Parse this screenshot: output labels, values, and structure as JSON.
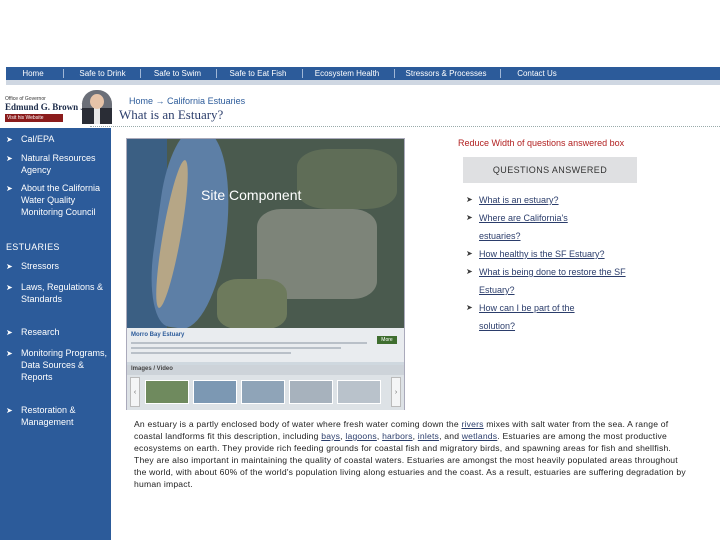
{
  "nav": {
    "items": [
      {
        "label": "Home"
      },
      {
        "label": "Safe to Drink"
      },
      {
        "label": "Safe to Swim"
      },
      {
        "label": "Safe to Eat Fish"
      },
      {
        "label": "Ecosystem Health"
      },
      {
        "label": "Stressors & Processes"
      },
      {
        "label": "Contact Us"
      }
    ]
  },
  "governor": {
    "office": "Office of Governor",
    "name": "Edmund G. Brown Jr.",
    "visit": "Visit his Website"
  },
  "breadcrumb": {
    "home": "Home",
    "current": "California Estuaries"
  },
  "page_title": "What is an Estuary?",
  "sidebar": {
    "items_top": [
      {
        "label": "Cal/EPA"
      },
      {
        "label": "Natural Resources Agency"
      },
      {
        "label": "About the California Water Quality Monitoring Council"
      }
    ],
    "section_heading": "ESTUARIES",
    "items_bottom": [
      {
        "label": "Stressors"
      },
      {
        "label": "Laws, Regulations & Standards"
      },
      {
        "label": "Research"
      },
      {
        "label": "Monitoring Programs, Data Sources & Reports"
      },
      {
        "label": "Restoration & Management"
      }
    ]
  },
  "site_component": {
    "label": "Site Component",
    "estuary_name": "Morro Bay Estuary",
    "more_button": "More",
    "media_title": "Images / Video",
    "prev": "‹",
    "next": "›"
  },
  "questions": {
    "note": "Reduce Width of questions answered box",
    "heading": "QUESTIONS ANSWERED",
    "items": [
      {
        "label": "What is an estuary?"
      },
      {
        "label": "Where are California's estuaries?"
      },
      {
        "label": "How healthy is the SF Estuary?"
      },
      {
        "label": "What is being done to restore the SF Estuary?"
      },
      {
        "label": "How can I be part of the solution?"
      }
    ]
  },
  "description": {
    "p1": "An estuary is a partly enclosed body of water where fresh water coming down the ",
    "rivers": "rivers",
    "p2": " mixes with salt water from the sea. A range of coastal landforms fit this description, including ",
    "bays": "bays",
    "sep1": ", ",
    "lagoons": "lagoons",
    "sep2": ", ",
    "harbors": "harbors",
    "sep3": ", ",
    "inlets": "inlets",
    "sep4": ", and ",
    "wetlands": "wetlands",
    "p3": ". Estuaries are among the most productive ecosystems on earth. They provide rich feeding grounds for coastal fish and migratory birds, and spawning areas for fish and shellfish. They are also important in maintaining the quality of coastal waters. Estuaries are amongst the most heavily populated areas throughout the world, with about 60% of the world's population living along estuaries and the coast. As a result, estuaries are suffering degradation by human impact."
  }
}
